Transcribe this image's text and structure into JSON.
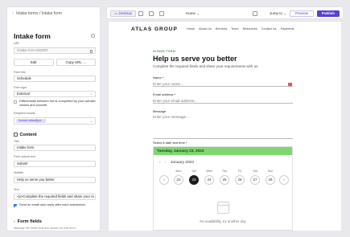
{
  "breadcrumb": {
    "part1": "Intake forms",
    "sep": "/",
    "part2": "Intake form"
  },
  "form": {
    "title": "Intake form",
    "url_label": "URL",
    "url_value": "/intake-form-552800",
    "edit_label": "Edit",
    "copy_url_label": "Copy URL",
    "form_title_label": "Form title",
    "form_title_value": "Schedule",
    "form_type_label": "Form type",
    "form_type_value": "External",
    "differentiate_label": "Differentiate between forms completed by your website visitors and yourself.",
    "recipient_label": "Recipient emails",
    "recipient_tag": "hrosen+atlas@pe..."
  },
  "content": {
    "section_title": "Content",
    "title_label": "Title",
    "title_value": "Intake form",
    "submit_label": "Form submit text",
    "submit_value": "Submit",
    "subtitle_label": "Subtitle",
    "subtitle_value": "Help us serve you better",
    "text_label": "Text",
    "text_value": "<p>Complete the required fields and share your re",
    "autoreply_label": "Send an email auto-reply after each submission."
  },
  "form_fields": {
    "section_title": "Form fields",
    "description": "Manage the fields that are shown on this form."
  },
  "toolbar": {
    "desktop_label": "Desktop",
    "page_select": "Home",
    "jump_label": "Jump to",
    "preview_label": "Preview",
    "publish_label": "Publish"
  },
  "site": {
    "brand": "ATLAS GROUP",
    "nav": [
      "Home",
      "About Us",
      "Services",
      "Team",
      "Resources",
      "Contact Us",
      "Payments"
    ],
    "kicker": "INTAKE FORM",
    "heading": "Help us serve you better",
    "subheading": "Complete the required fields and share your requirements with us.",
    "name_label": "Name *",
    "name_placeholder": "Enter your name...",
    "email_label": "Email address *",
    "email_placeholder": "Enter your email address...",
    "message_label": "Message",
    "message_placeholder": "Enter your message...",
    "date_label": "Select a date and time *",
    "selected_date": "Tuesday, January 23, 2024",
    "month_label": "January 2024",
    "weekdays": [
      "Mon",
      "Tue",
      "Wed",
      "Thu",
      "Fri",
      "Sat",
      "Sun"
    ],
    "days": [
      "22",
      "23",
      "24",
      "25",
      "26",
      "27",
      "28"
    ],
    "no_availability": "No availability, try another day"
  },
  "colors": {
    "accent": "#5a3fd3",
    "calendar_header": "#7ed66e",
    "kicker": "#4f9d48"
  }
}
